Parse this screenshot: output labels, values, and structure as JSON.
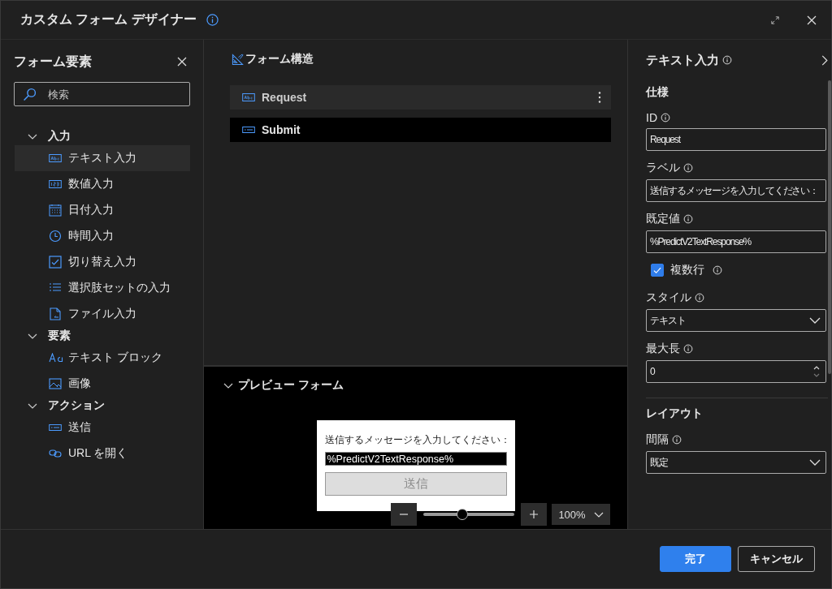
{
  "window": {
    "title": "カスタム フォーム デザイナー"
  },
  "elements_panel": {
    "title": "フォーム要素",
    "search": {
      "placeholder": "検索"
    },
    "groups": [
      {
        "label": "入力",
        "expanded": true,
        "items": [
          {
            "label": "テキスト入力",
            "kind": "text",
            "selected": true
          },
          {
            "label": "数値入力",
            "kind": "number",
            "selected": false
          },
          {
            "label": "日付入力",
            "kind": "date",
            "selected": false
          },
          {
            "label": "時間入力",
            "kind": "time",
            "selected": false
          },
          {
            "label": "切り替え入力",
            "kind": "toggle",
            "selected": false
          },
          {
            "label": "選択肢セットの入力",
            "kind": "choice",
            "selected": false
          },
          {
            "label": "ファイル入力",
            "kind": "file",
            "selected": false
          }
        ]
      },
      {
        "label": "要素",
        "expanded": true,
        "items": [
          {
            "label": "テキスト ブロック",
            "kind": "textblock",
            "selected": false
          },
          {
            "label": "画像",
            "kind": "image",
            "selected": false
          }
        ]
      },
      {
        "label": "アクション",
        "expanded": true,
        "items": [
          {
            "label": "送信",
            "kind": "submit",
            "selected": false
          },
          {
            "label": "URL を開く",
            "kind": "url",
            "selected": false
          }
        ]
      }
    ]
  },
  "form_structure": {
    "title": "フォーム構造",
    "items": [
      {
        "label": "Request",
        "kind": "text",
        "selected": true
      },
      {
        "label": "Submit",
        "kind": "submit",
        "selected": false
      }
    ]
  },
  "preview": {
    "title": "プレビュー フォーム",
    "expanded": true,
    "label": "送信するメッセージを入力してください：",
    "value": "%PredictV2TextResponse%",
    "button": "送信",
    "zoom": {
      "level": 0.43,
      "value": "100%"
    }
  },
  "properties": {
    "title": "テキスト入力",
    "section": "仕様",
    "fields": [
      {
        "kind": "text",
        "label": "ID",
        "value": "Request"
      },
      {
        "kind": "text",
        "label": "ラベル",
        "value": "送信するメッセージを入力してください："
      },
      {
        "kind": "text",
        "label": "既定値",
        "value": "%PredictV2TextResponse%"
      },
      {
        "kind": "checkbox",
        "label": "複数行",
        "checked": true
      },
      {
        "kind": "select",
        "label": "スタイル",
        "value": "テキスト"
      },
      {
        "kind": "number",
        "label": "最大長",
        "value": "0"
      }
    ],
    "layout_section": "レイアウト",
    "layout_fields": [
      {
        "kind": "select",
        "label": "間隔",
        "value": "既定"
      }
    ]
  },
  "footer": {
    "buttons": [
      {
        "label": "完了",
        "primary": true
      },
      {
        "label": "キャンセル",
        "primary": false
      }
    ]
  }
}
